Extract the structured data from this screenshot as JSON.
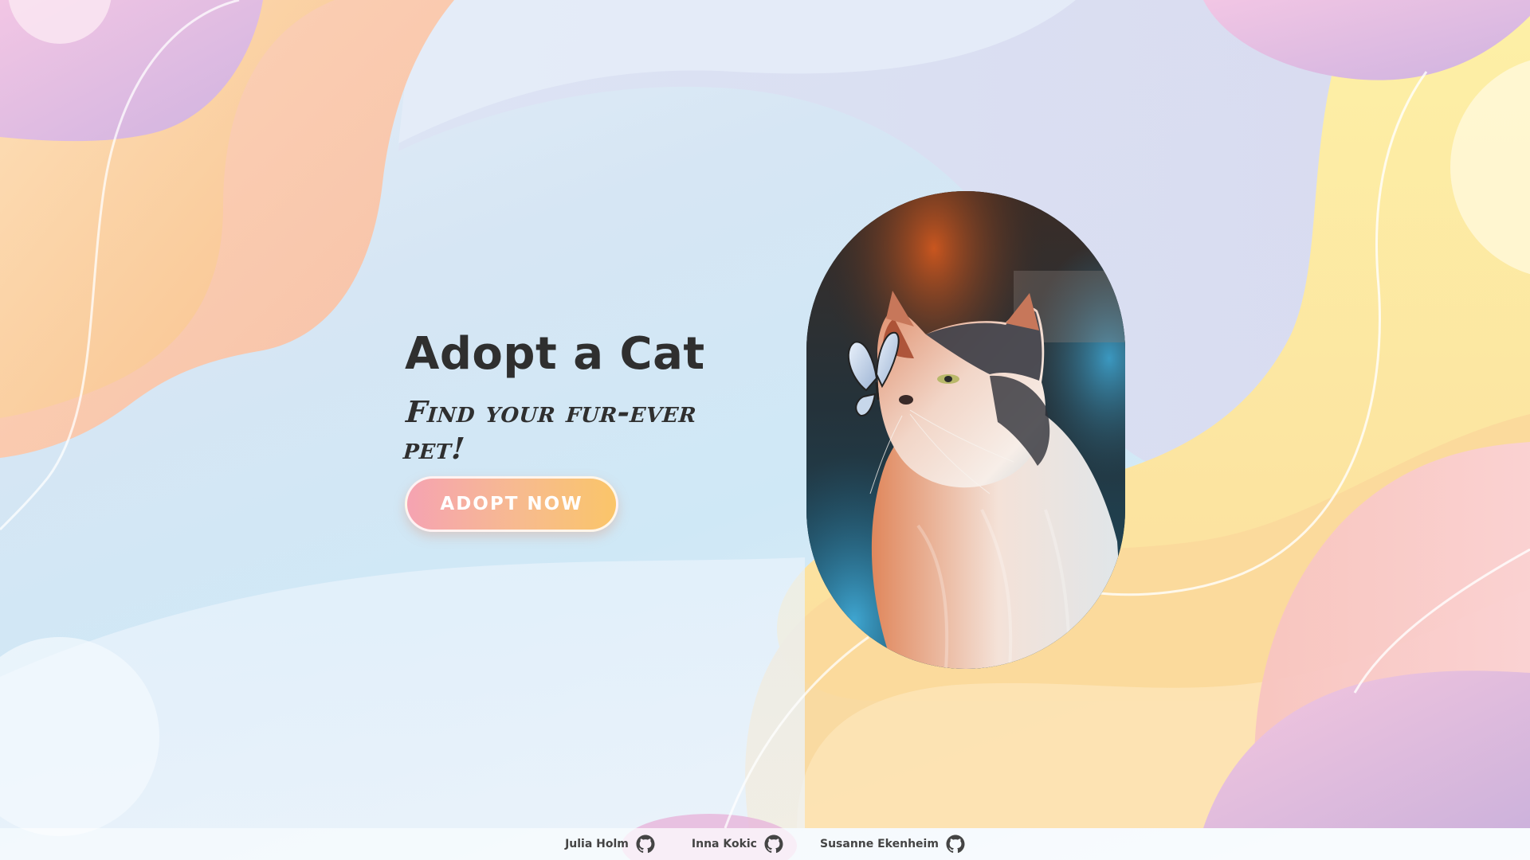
{
  "hero": {
    "title": "Adopt a Cat",
    "subtitle": "Find your fur-ever pet!",
    "cta_label": "ADOPT NOW"
  },
  "photo": {
    "description_icon": "cat-with-butterfly-image"
  },
  "footer": {
    "credits": [
      {
        "name": "Julia Holm",
        "icon": "github-icon"
      },
      {
        "name": "Inna Kokic",
        "icon": "github-icon"
      },
      {
        "name": "Susanne Ekenheim",
        "icon": "github-icon"
      }
    ]
  },
  "colors": {
    "text": "#2f2f2f",
    "cta_start": "#f5a3b2",
    "cta_end": "#fac569",
    "blob_pink": "#e9b7d9",
    "blob_orange": "#f9c7a8",
    "blob_yellow": "#fde9a0",
    "sky": "#d6e6f4"
  }
}
